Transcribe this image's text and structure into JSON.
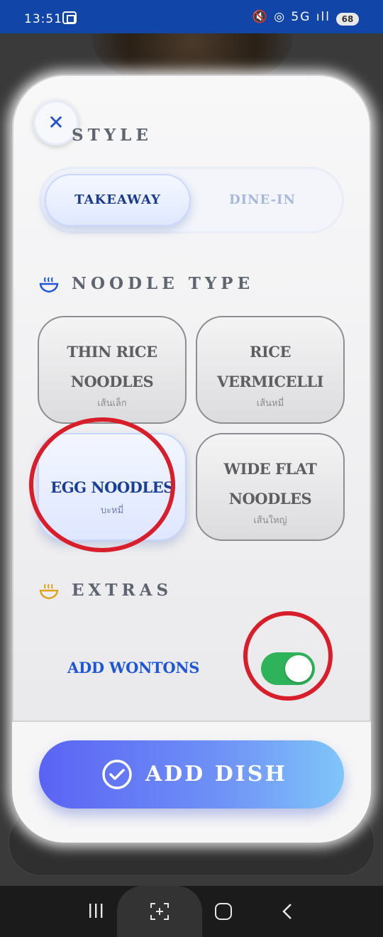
{
  "status_bar": {
    "time": "13:51",
    "signal_text": "🔇 ◎ 5G ıll",
    "battery": "68"
  },
  "sheet": {
    "style_title": "STYLE",
    "style_options": {
      "takeaway": "TAKEAWAY",
      "dine_in": "DINE-IN",
      "selected": "TAKEAWAY"
    },
    "noodle_title": "NOODLE TYPE",
    "noodle_options": [
      {
        "name": "THIN RICE NOODLES",
        "line1": "THIN RICE",
        "line2": "NOODLES",
        "thai": "เส้นเล็ก",
        "selected": false
      },
      {
        "name": "RICE VERMICELLI",
        "line1": "RICE",
        "line2": "VERMICELLI",
        "thai": "เส้นหมี่",
        "selected": false
      },
      {
        "name": "EGG NOODLES",
        "line1": "EGG NOODLES",
        "thai": "บะหมี่",
        "selected": true
      },
      {
        "name": "WIDE FLAT NOODLES",
        "line1": "WIDE FLAT",
        "line2": "NOODLES",
        "thai": "เส้นใหญ่",
        "selected": false
      }
    ],
    "extras_title": "EXTRAS",
    "extras": {
      "add_wontons_label": "ADD WONTONS",
      "add_wontons_on": true
    },
    "add_button_label": "ADD DISH"
  },
  "colors": {
    "status_bar": "#1145a8",
    "accent_blue": "#1f56d6",
    "toggle_on": "#2fb35a",
    "annotation_red": "#d81e2a"
  }
}
